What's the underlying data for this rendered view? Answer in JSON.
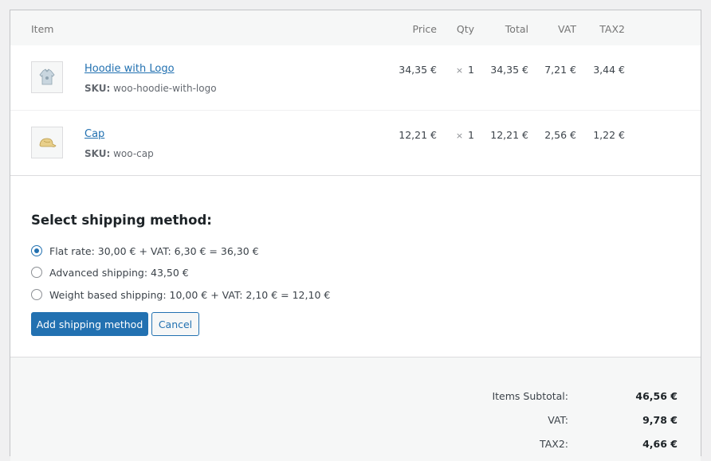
{
  "table": {
    "headers": {
      "item": "Item",
      "price": "Price",
      "qty": "Qty",
      "total": "Total",
      "vat": "VAT",
      "tax2": "TAX2"
    },
    "rows": [
      {
        "name": "Hoodie with Logo",
        "sku_label": "SKU:",
        "sku": "woo-hoodie-with-logo",
        "price": "34,35 €",
        "qty_symbol": "×",
        "qty": "1",
        "total": "34,35 €",
        "vat": "7,21 €",
        "tax2": "3,44 €",
        "thumb_icon": "hoodie-icon"
      },
      {
        "name": "Cap",
        "sku_label": "SKU:",
        "sku": "woo-cap",
        "price": "12,21 €",
        "qty_symbol": "×",
        "qty": "1",
        "total": "12,21 €",
        "vat": "2,56 €",
        "tax2": "1,22 €",
        "thumb_icon": "cap-icon"
      }
    ]
  },
  "shipping": {
    "title": "Select shipping method:",
    "options": [
      {
        "label": "Flat rate: 30,00 € + VAT: 6,30 € = 36,30 €",
        "selected": true
      },
      {
        "label": "Advanced shipping: 43,50 €",
        "selected": false
      },
      {
        "label": "Weight based shipping: 10,00 € + VAT: 2,10 € = 12,10 €",
        "selected": false
      }
    ],
    "add_button": "Add shipping method",
    "cancel_button": "Cancel"
  },
  "totals": [
    {
      "label": "Items Subtotal:",
      "value": "46,56 €"
    },
    {
      "label": "VAT:",
      "value": "9,78 €"
    },
    {
      "label": "TAX2:",
      "value": "4,66 €"
    }
  ],
  "colors": {
    "accent": "#2271b1",
    "border": "#c3c4c7",
    "header_bg": "#f6f7f7"
  }
}
